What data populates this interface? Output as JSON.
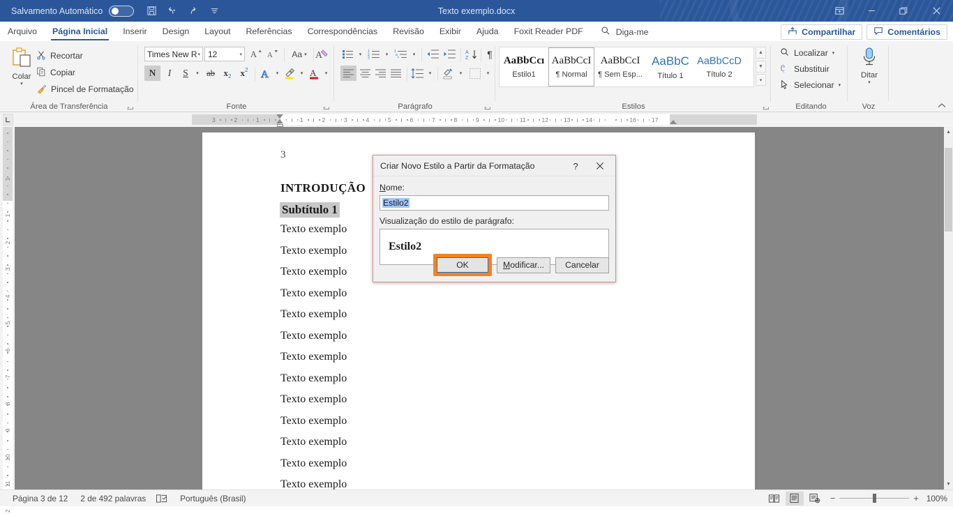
{
  "titlebar": {
    "autosave_label": "Salvamento Automático",
    "autosave_state": "off",
    "doc_title": "Texto exemplo.docx",
    "quick_access": [
      "save-icon",
      "undo-icon",
      "redo-icon",
      "customize-qat-icon"
    ],
    "window_buttons": [
      "ribbon-display-options",
      "minimize",
      "restore",
      "close"
    ]
  },
  "tabs": [
    {
      "label": "Arquivo",
      "active": false
    },
    {
      "label": "Página Inicial",
      "active": true
    },
    {
      "label": "Inserir",
      "active": false
    },
    {
      "label": "Design",
      "active": false
    },
    {
      "label": "Layout",
      "active": false
    },
    {
      "label": "Referências",
      "active": false
    },
    {
      "label": "Correspondências",
      "active": false
    },
    {
      "label": "Revisão",
      "active": false
    },
    {
      "label": "Exibir",
      "active": false
    },
    {
      "label": "Ajuda",
      "active": false
    },
    {
      "label": "Foxit Reader PDF",
      "active": false
    }
  ],
  "tellme": {
    "label": "Diga-me",
    "icon": "search-icon"
  },
  "top_right": {
    "share": "Compartilhar",
    "comments": "Comentários"
  },
  "ribbon": {
    "clipboard": {
      "group_label": "Área de Transferência",
      "paste_label": "Colar",
      "items": [
        {
          "label": "Recortar",
          "icon": "scissors-icon"
        },
        {
          "label": "Copiar",
          "icon": "copy-icon"
        },
        {
          "label": "Pincel de Formatação",
          "icon": "format-painter-icon"
        }
      ]
    },
    "font": {
      "group_label": "Fonte",
      "font_name": "Times New R",
      "font_size": "12",
      "grow_font": "A",
      "shrink_font": "A",
      "change_case": "Aa",
      "clear_formatting": "clear-formatting-icon",
      "bold": "N",
      "italic": "I",
      "underline": "S",
      "strikethrough": "ab",
      "subscript": "x",
      "superscript": "x",
      "text_effects": "A",
      "highlight": "highlight-icon",
      "font_color": "A",
      "bold_active": true
    },
    "paragraph": {
      "group_label": "Parágrafo",
      "buttons": [
        "bullets-icon",
        "numbering-icon",
        "multilevel-list-icon",
        "decrease-indent-icon",
        "increase-indent-icon",
        "sort-icon",
        "show-marks-icon",
        "align-left-icon",
        "align-center-icon",
        "align-right-icon",
        "justify-icon",
        "line-spacing-icon",
        "shading-icon",
        "borders-icon"
      ],
      "align_left_active": true
    },
    "styles": {
      "group_label": "Estilos",
      "items": [
        {
          "preview": "AaBbCcı",
          "name": "Estilo1",
          "selected": false,
          "serif": true,
          "bold": true,
          "color": "#1a1a1a"
        },
        {
          "preview": "AaBbCcI",
          "name": "¶ Normal",
          "selected": true,
          "serif": true,
          "bold": false,
          "color": "#1a1a1a"
        },
        {
          "preview": "AaBbCcI",
          "name": "¶ Sem Esp...",
          "selected": false,
          "serif": true,
          "bold": false,
          "color": "#1a1a1a"
        },
        {
          "preview": "AaBbC",
          "name": "Título 1",
          "selected": false,
          "serif": false,
          "bold": false,
          "color": "#2e74b5"
        },
        {
          "preview": "AaBbCcD",
          "name": "Título 2",
          "selected": false,
          "serif": false,
          "bold": false,
          "color": "#2e74b5"
        }
      ]
    },
    "editing": {
      "group_label": "Editando",
      "items": [
        {
          "label": "Localizar",
          "icon": "search-icon",
          "has_caret": true
        },
        {
          "label": "Substituir",
          "icon": "replace-icon",
          "has_caret": false
        },
        {
          "label": "Selecionar",
          "icon": "select-icon",
          "has_caret": true
        }
      ]
    },
    "voice": {
      "group_label": "Voz",
      "dictate_label": "Ditar",
      "icon": "microphone-icon"
    },
    "collapse_ribbon_icon": "chevron-up-icon"
  },
  "ruler": {
    "h_labels_left": [
      "3",
      "2",
      "1"
    ],
    "h_labels_right": [
      "1",
      "2",
      "3",
      "4",
      "5",
      "6",
      "7",
      "8",
      "9",
      "10",
      "11",
      "12",
      "13",
      "14",
      "16",
      "17"
    ],
    "v_labels": [
      "1",
      "1",
      "2",
      "3",
      "4",
      "5",
      "6",
      "7",
      "8",
      "9",
      "10",
      "11",
      "2"
    ],
    "tab_selector_icon": "tab-left-icon"
  },
  "document": {
    "page_number": "3",
    "heading1": "INTRODUÇÃO",
    "heading2": "Subtítulo 1",
    "heading2_selected": true,
    "paragraphs": [
      "Texto exemplo",
      "Texto exemplo",
      "Texto exemplo",
      "Texto exemplo",
      "Texto exemplo",
      "Texto exemplo",
      "Texto exemplo",
      "Texto exemplo",
      "Texto exemplo",
      "Texto exemplo",
      "Texto exemplo",
      "Texto exemplo",
      "Texto exemplo"
    ]
  },
  "dialog": {
    "title": "Criar Novo Estilo a Partir da Formatação",
    "help_icon": "?",
    "close_icon": "close-icon",
    "name_label": "Nome:",
    "name_label_accel": "N",
    "name_value": "Estilo2",
    "name_selected": true,
    "preview_label": "Visualização do estilo de parágrafo:",
    "preview_text": "Estilo2",
    "buttons": [
      {
        "label": "OK",
        "name": "ok-button",
        "focused": true,
        "highlighted": true,
        "highlight_color": "#f58220"
      },
      {
        "label": "Modificar...",
        "name": "modify-button",
        "accel": "M",
        "focused": false
      },
      {
        "label": "Cancelar",
        "name": "cancel-button",
        "focused": false
      }
    ]
  },
  "statusbar": {
    "page_info": "Página 3 de 12",
    "word_count": "2 de 492 palavras",
    "proofing_icon": "proofing-icon",
    "language": "Português (Brasil)",
    "view_buttons": [
      "read-mode-icon",
      "print-layout-icon",
      "web-layout-icon"
    ],
    "active_view": "print-layout-icon",
    "zoom_out": "−",
    "zoom_in": "+",
    "zoom_value": "100%"
  },
  "colors": {
    "titlebar": "#2b579a",
    "accent": "#2b579a",
    "highlight_orange": "#f58220",
    "focus_blue": "#1a73c8",
    "selection_blue": "#9fc5f8",
    "dialog_border": "#d98b8b"
  }
}
